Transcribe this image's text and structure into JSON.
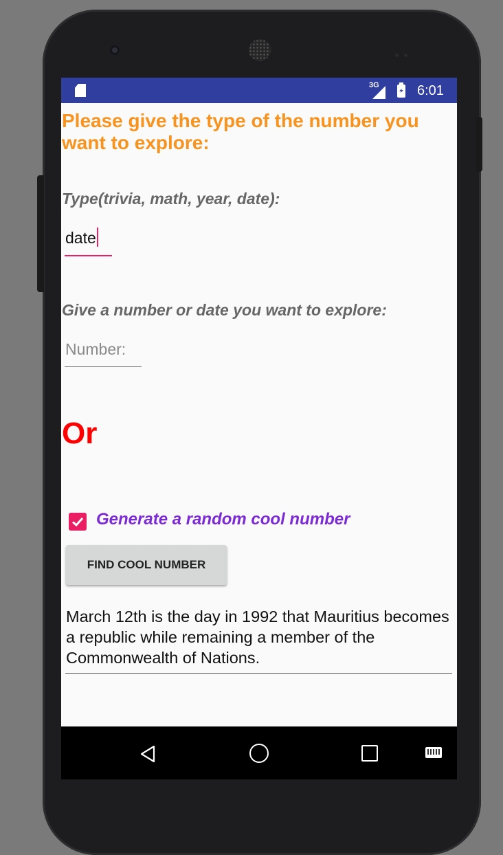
{
  "status_bar": {
    "network_type": "3G",
    "time": "6:01",
    "color": "#303f9f"
  },
  "form": {
    "heading": "Please give the type of the number you want to explore:",
    "type_label": "Type(trivia, math, year, date):",
    "type_value": "date",
    "number_label": "Give a number or date you want to explore:",
    "number_placeholder": "Number:",
    "or_label": "Or",
    "random_checkbox": {
      "label": "Generate a random cool number",
      "checked": true
    },
    "find_button_label": "FIND COOL NUMBER",
    "result_text": "March 12th is the day in 1992 that Mauritius becomes a republic while remaining a member of the Commonwealth of Nations."
  },
  "nav_bar": {
    "icons": [
      "back-icon",
      "home-icon",
      "recents-icon",
      "keyboard-icon"
    ]
  },
  "colors": {
    "heading": "#f7931e",
    "or": "#ff0000",
    "checkbox_label": "#7b2ad6",
    "accent": "#e91e63"
  }
}
